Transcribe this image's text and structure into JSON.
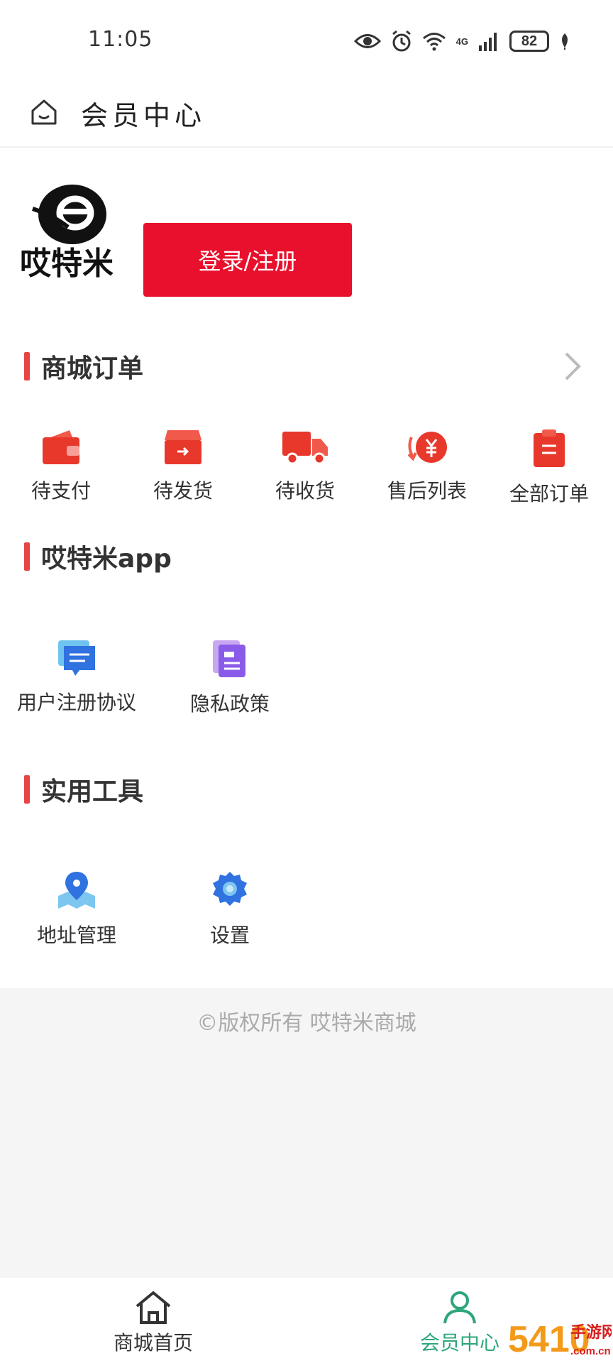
{
  "status_bar": {
    "time": "11:05",
    "network": "4G",
    "battery": "82"
  },
  "header": {
    "title": "会员中心"
  },
  "profile": {
    "brand_text": "哎特米",
    "login_label": "登录/注册"
  },
  "orders": {
    "title": "商城订单",
    "items": [
      {
        "label": "待支付",
        "icon": "wallet-icon"
      },
      {
        "label": "待发货",
        "icon": "box-icon"
      },
      {
        "label": "待收货",
        "icon": "truck-icon"
      },
      {
        "label": "售后列表",
        "icon": "refund-icon"
      },
      {
        "label": "全部订单",
        "icon": "clipboard-icon"
      }
    ]
  },
  "app": {
    "title": "哎特米app",
    "items": [
      {
        "label": "用户注册协议",
        "icon": "chat-doc-icon"
      },
      {
        "label": "隐私政策",
        "icon": "document-icon"
      }
    ]
  },
  "tools": {
    "title": "实用工具",
    "items": [
      {
        "label": "地址管理",
        "icon": "location-icon"
      },
      {
        "label": "设置",
        "icon": "gear-icon"
      }
    ]
  },
  "footer": {
    "copyright": "©版权所有 哎特米商城"
  },
  "bottom_nav": {
    "items": [
      {
        "label": "商城首页",
        "icon": "home-icon"
      },
      {
        "label": "会员中心",
        "icon": "user-icon"
      }
    ]
  },
  "watermark": {
    "number": "5410",
    "text": "手游网",
    "domain": ".com.cn"
  },
  "colors": {
    "accent": "#e8102c",
    "active_nav": "#2ea67a",
    "section_bar": "#e64545"
  }
}
